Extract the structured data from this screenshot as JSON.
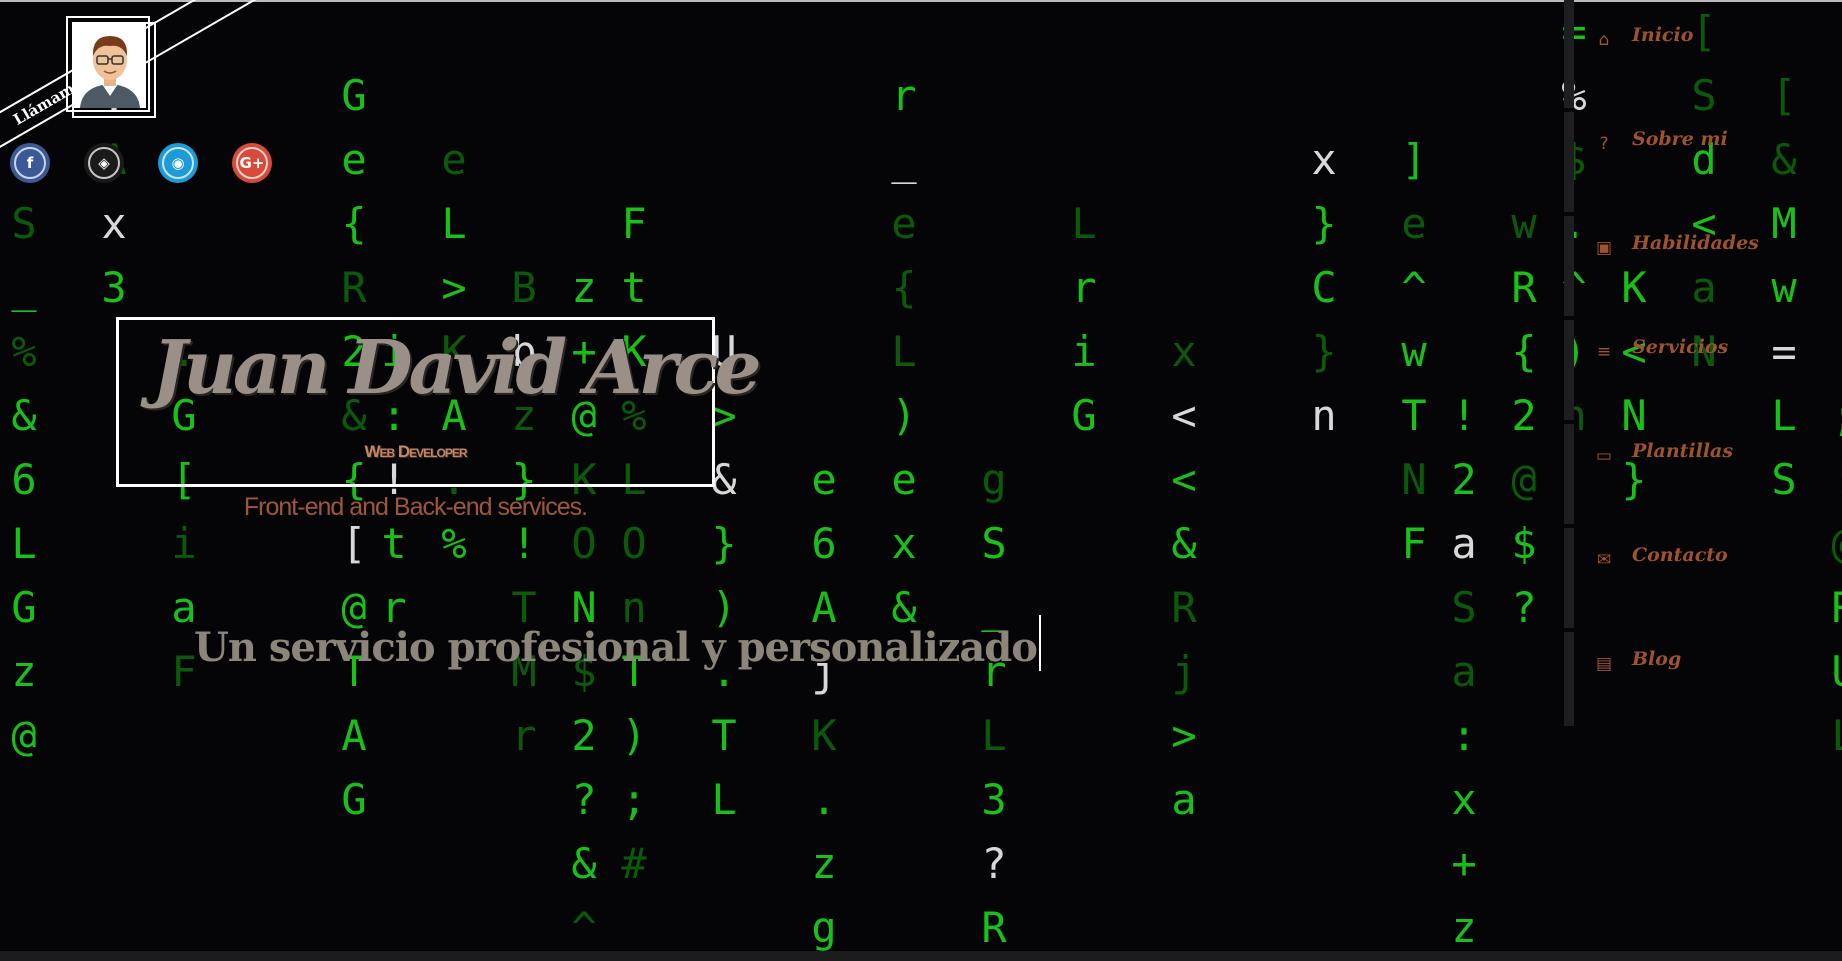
{
  "call_ribbon": {
    "label": "Llámame"
  },
  "social": [
    {
      "name": "facebook",
      "glyph": "f",
      "color": "#3b5998"
    },
    {
      "name": "codepen",
      "glyph": "◈",
      "color": "#1a1a1a"
    },
    {
      "name": "github",
      "glyph": "◉",
      "color": "#1e9ad6"
    },
    {
      "name": "google-plus",
      "glyph": "G+",
      "color": "#d64b3a"
    }
  ],
  "hero": {
    "name": "Juan David Arce",
    "role": "Web Developer",
    "services": "Front-end and Back-end services.",
    "tagline": "Un servicio profesional y personalizado"
  },
  "nav": {
    "items": [
      {
        "id": "inicio",
        "label": "Inicio",
        "icon": "home-icon",
        "glyph": "⌂"
      },
      {
        "id": "sobre-mi",
        "label": "Sobre mi",
        "icon": "question-icon",
        "glyph": "?"
      },
      {
        "id": "habilidades",
        "label": "Habilidades",
        "icon": "briefcase-icon",
        "glyph": "▣"
      },
      {
        "id": "servicios",
        "label": "Servicios",
        "icon": "server-icon",
        "glyph": "≡"
      },
      {
        "id": "plantillas",
        "label": "Plantillas",
        "icon": "laptop-icon",
        "glyph": "▭"
      },
      {
        "id": "contacto",
        "label": "Contacto",
        "icon": "envelope-icon",
        "glyph": "✉"
      },
      {
        "id": "blog",
        "label": "Blog",
        "icon": "book-icon",
        "glyph": "▤"
      }
    ]
  },
  "colors": {
    "accent": "#a0522d",
    "matrix_green": "#18c018",
    "background": "#050508"
  }
}
